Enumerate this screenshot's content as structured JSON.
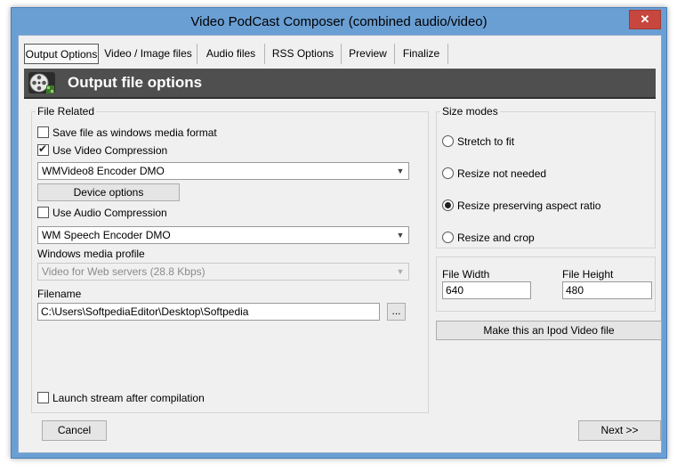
{
  "window": {
    "title": "Video PodCast Composer (combined audio/video)",
    "close_glyph": "✕"
  },
  "tabs": [
    {
      "label": "Output Options",
      "active": true
    },
    {
      "label": "Video / Image files",
      "active": false
    },
    {
      "label": "Audio files",
      "active": false
    },
    {
      "label": "RSS Options",
      "active": false
    },
    {
      "label": "Preview",
      "active": false
    },
    {
      "label": "Finalize",
      "active": false
    }
  ],
  "header": {
    "title": "Output file options",
    "icon": "film-reel-icon"
  },
  "file_related": {
    "group_label": "File Related",
    "save_wmf": {
      "label": "Save file as windows media format",
      "checked": false
    },
    "use_video_compression": {
      "label": "Use Video Compression",
      "checked": true
    },
    "video_codec": "WMVideo8 Encoder DMO",
    "device_options_label": "Device options",
    "use_audio_compression": {
      "label": "Use Audio Compression",
      "checked": false
    },
    "audio_codec": "WM Speech Encoder DMO",
    "profile_label": "Windows media profile",
    "profile_value": "Video for Web servers (28.8 Kbps)",
    "filename_label": "Filename",
    "filename_value": "C:\\Users\\SoftpediaEditor\\Desktop\\Softpedia",
    "browse_label": "...",
    "launch_stream": {
      "label": "Launch stream after compilation",
      "checked": false
    }
  },
  "size_modes": {
    "group_label": "Size modes",
    "options": [
      {
        "label": "Stretch to fit",
        "checked": false
      },
      {
        "label": "Resize not needed",
        "checked": false
      },
      {
        "label": "Resize preserving aspect ratio",
        "checked": true
      },
      {
        "label": "Resize and crop",
        "checked": false
      }
    ]
  },
  "dimensions": {
    "width_label": "File Width",
    "width_value": "640",
    "height_label": "File Height",
    "height_value": "480"
  },
  "ipod_button_label": "Make this an Ipod Video file",
  "footer": {
    "cancel_label": "Cancel",
    "next_label": "Next >>"
  },
  "colors": {
    "frame": "#6a9fd4",
    "header_bg": "#4f4f4f",
    "close_btn": "#c7463d"
  }
}
